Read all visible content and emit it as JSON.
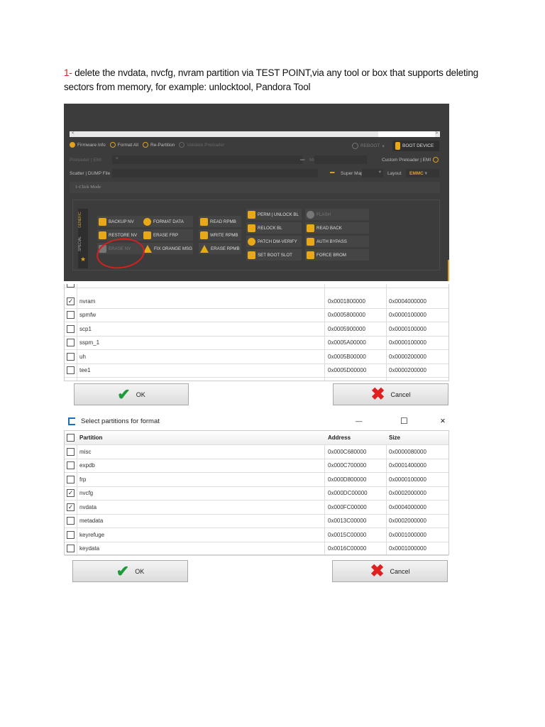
{
  "instruction": {
    "step": "1-",
    "line1": " delete the nvdata, nvcfg, nvram partition via TEST POINT,via any tool or box that supports deleting",
    "line2": "sectors from memory, for example: unlocktool, Pandora Tool"
  },
  "tool": {
    "scroll_left": "<",
    "scroll_right": ">",
    "options": [
      {
        "label": "Firmware Info",
        "state": "checked"
      },
      {
        "label": "Format All",
        "state": "unchecked"
      },
      {
        "label": "Re-Partition",
        "state": "unchecked"
      },
      {
        "label": "Validate Preloader",
        "state": "disabled"
      }
    ],
    "reboot_label": "REBOOT",
    "boot_device_label": "BOOT DEVICE",
    "preloader_label": "Preloader | EMI",
    "model_label": "Model",
    "custom_preloader_label": "Custom Preloader | EMI",
    "scatter_label": "Scatter | DUMP File",
    "super_map_label": "Super Map",
    "layout_label": "Layout",
    "layout_value": "EMMC",
    "mode_label": "1-Click Mode",
    "side_tabs": [
      "GENERIC",
      "SPECIAL"
    ],
    "buttons": [
      {
        "label": "BACKUP NV",
        "icon": "database-icon"
      },
      {
        "label": "RESTORE NV",
        "icon": "database-icon"
      },
      {
        "label": "ERASE NV",
        "icon": "database-icon",
        "disabled": true
      },
      {
        "label": "FORMAT DATA",
        "icon": "refresh-icon"
      },
      {
        "label": "ERASE FRP",
        "icon": "eraser-icon"
      },
      {
        "label": "FIX ORANGE MSG",
        "icon": "warning-icon"
      },
      {
        "label": "READ RPMB",
        "icon": "download-icon"
      },
      {
        "label": "WRITE RPMB",
        "icon": "upload-icon"
      },
      {
        "label": "ERASE RPMB",
        "icon": "warning-icon"
      },
      {
        "label": "PERM | UNLOCK BL",
        "icon": "unlock-icon"
      },
      {
        "label": "RELOCK BL",
        "icon": "lock-icon"
      },
      {
        "label": "PATCH DM-VERIFY",
        "icon": "check-icon"
      },
      {
        "label": "SET BOOT SLOT",
        "icon": "fork-icon"
      },
      {
        "label": "FLASH",
        "icon": "flash-icon",
        "disabled": true
      },
      {
        "label": "READ BACK",
        "icon": "save-icon"
      },
      {
        "label": "AUTH BYPASS",
        "icon": "key-icon"
      },
      {
        "label": "FORCE BROM",
        "icon": "key-icon"
      }
    ],
    "highlight_color": "#d42020"
  },
  "table1": {
    "rows": [
      {
        "name": "nvram",
        "address": "0x0001800000",
        "size": "0x0004000000",
        "checked": true
      },
      {
        "name": "spmfw",
        "address": "0x0005800000",
        "size": "0x0000100000",
        "checked": false
      },
      {
        "name": "scp1",
        "address": "0x0005900000",
        "size": "0x0000100000",
        "checked": false
      },
      {
        "name": "sspm_1",
        "address": "0x0005A00000",
        "size": "0x0000100000",
        "checked": false
      },
      {
        "name": "uh",
        "address": "0x0005B00000",
        "size": "0x0000200000",
        "checked": false
      },
      {
        "name": "tee1",
        "address": "0x0005D00000",
        "size": "0x0000200000",
        "checked": false
      }
    ],
    "ok_label": "OK",
    "cancel_label": "Cancel"
  },
  "dialog": {
    "title": "Select partitions for format",
    "minimize": "—",
    "maximize": "☐",
    "close": "✕",
    "headers": [
      "Partition",
      "Address",
      "Size"
    ],
    "rows": [
      {
        "name": "misc",
        "address": "0x000C680000",
        "size": "0x0000080000",
        "checked": false
      },
      {
        "name": "expdb",
        "address": "0x000C700000",
        "size": "0x0001400000",
        "checked": false
      },
      {
        "name": "frp",
        "address": "0x000D800000",
        "size": "0x0000100000",
        "checked": false
      },
      {
        "name": "nvcfg",
        "address": "0x000DC00000",
        "size": "0x0002000000",
        "checked": true
      },
      {
        "name": "nvdata",
        "address": "0x000FC00000",
        "size": "0x0004000000",
        "checked": true
      },
      {
        "name": "metadata",
        "address": "0x0013C00000",
        "size": "0x0002000000",
        "checked": false
      },
      {
        "name": "keyrefuge",
        "address": "0x0015C00000",
        "size": "0x0001000000",
        "checked": false
      },
      {
        "name": "keydata",
        "address": "0x0016C00000",
        "size": "0x0001000000",
        "checked": false
      }
    ],
    "ok_label": "OK",
    "cancel_label": "Cancel"
  }
}
